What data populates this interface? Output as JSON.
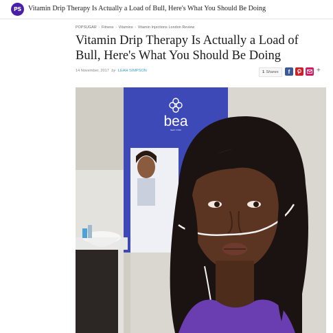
{
  "site": {
    "logo_text": "PS",
    "topbar_title": "Vitamin Drip Therapy Is Actually a Load of Bull, Here's What You Should Be Doing"
  },
  "breadcrumb": {
    "items": [
      "POPSUGAR",
      "Fitness",
      "Vitamins",
      "Vitamin Injections London Review"
    ],
    "separator": "›"
  },
  "article": {
    "title": "Vitamin Drip Therapy Is Actually a Load of Bull, Here's What You Should Be Doing",
    "date": "14 November, 2017",
    "by": "by",
    "author": "LEAH SIMPSON",
    "shares_count": "1",
    "shares_label": "Shares"
  },
  "share": {
    "facebook_icon": "facebook-icon",
    "pinterest_icon": "pinterest-icon",
    "email_icon": "email-icon",
    "more_icon": "plus-icon",
    "plus": "+"
  },
  "photo": {
    "sign_brand": "bea",
    "sign_sub": "NEW YORK",
    "colors": {
      "sign": "#3e49b8",
      "wall": "#dcdad3",
      "top": "#7b4fb4"
    }
  }
}
